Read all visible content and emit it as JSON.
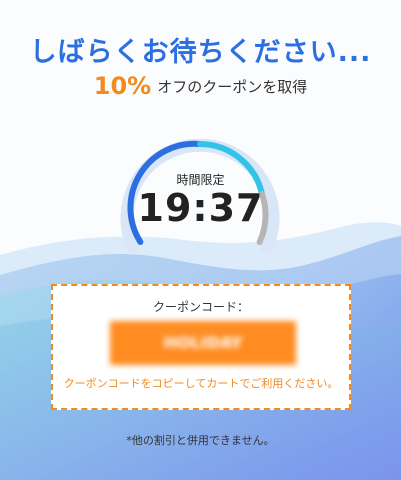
{
  "header": {
    "title": "しばらくお待ちください...",
    "discount": "10%",
    "subtitle": "オフのクーポンを取得"
  },
  "timer": {
    "label": "時間限定",
    "value": "19:37",
    "progress_fraction": 0.75
  },
  "coupon": {
    "label": "クーポンコード：",
    "code": "HOLIDAY",
    "instruction": "クーポンコードをコピーしてカートでご利用ください。"
  },
  "footer": {
    "note": "*他の割引と併用できません。"
  },
  "colors": {
    "accent_blue": "#2c6fe0",
    "accent_orange": "#f28a1e",
    "progress_cyan": "#32c4e6",
    "progress_gray": "#b5b5b5"
  }
}
